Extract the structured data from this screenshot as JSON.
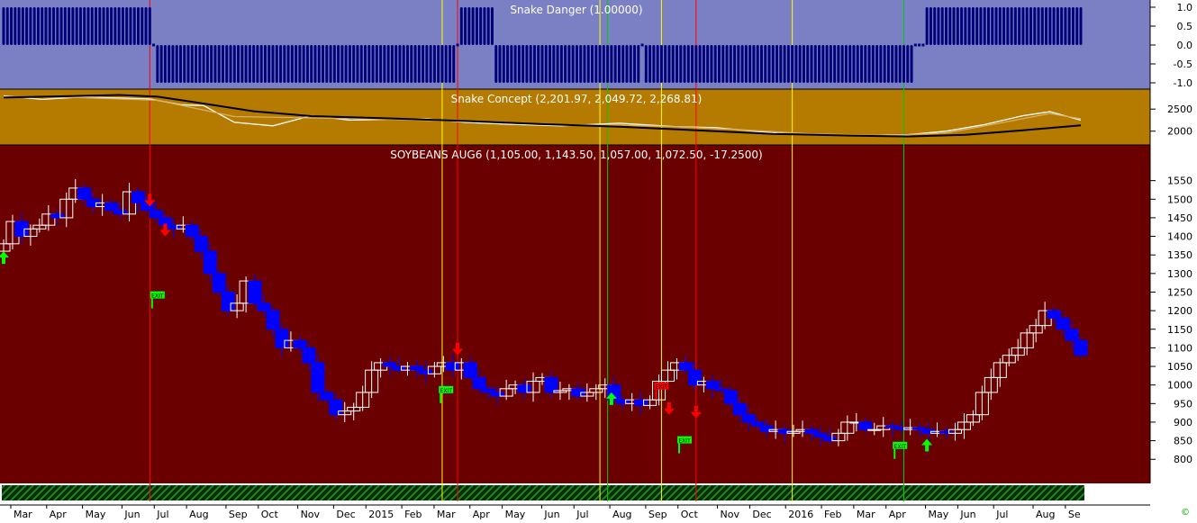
{
  "colors": {
    "danger_bg": "#7b7fc4",
    "concept_bg": "#b57a00",
    "price_bg": "#6b0000",
    "bar_blue": "#0000ff",
    "bar_white": "#ffffff",
    "signal_red": "#ff0000",
    "signal_green": "#00ff00",
    "vline_yellow": "#ffff00",
    "vline_red": "#ff0000",
    "vline_green": "#00cc00",
    "axis_bg": "#ffffff",
    "hatch": "#1a8a1a"
  },
  "chart_data": [
    {
      "type": "bar",
      "title": "Snake Danger (1.00000)",
      "ylim": [
        -1.0,
        1.0
      ],
      "yticks": [
        "1.0",
        "0.5",
        "0.0",
        "-0.5",
        "-1.0"
      ],
      "note_values": "weekly state: 1 = up, -1 = down, 0 = neutral",
      "segments": [
        {
          "from_week": 0,
          "to_week": 38,
          "value": 1
        },
        {
          "from_week": 39,
          "to_week": 39,
          "value": 0
        },
        {
          "from_week": 40,
          "to_week": 117,
          "value": -1
        },
        {
          "from_week": 118,
          "to_week": 118,
          "value": 0
        },
        {
          "from_week": 119,
          "to_week": 127,
          "value": 1
        },
        {
          "from_week": 128,
          "to_week": 165,
          "value": -1
        },
        {
          "from_week": 166,
          "to_week": 166,
          "value": 0
        },
        {
          "from_week": 167,
          "to_week": 236,
          "value": -1
        },
        {
          "from_week": 237,
          "to_week": 239,
          "value": 0
        },
        {
          "from_week": 240,
          "to_week": 280,
          "value": 1
        }
      ]
    },
    {
      "type": "line",
      "title": "Snake Concept (2,201.97, 2,049.72, 2,268.81)",
      "ylim": [
        1750,
        2850
      ],
      "yticks": [
        "2500",
        "2000"
      ],
      "series": [
        {
          "name": "",
          "color": "#ffffff",
          "points": [
            [
              0,
              2800
            ],
            [
              10,
              2720
            ],
            [
              20,
              2770
            ],
            [
              30,
              2750
            ],
            [
              38,
              2730
            ],
            [
              46,
              2600
            ],
            [
              52,
              2580
            ],
            [
              60,
              2200
            ],
            [
              70,
              2120
            ],
            [
              80,
              2350
            ],
            [
              90,
              2250
            ],
            [
              100,
              2270
            ],
            [
              110,
              2280
            ],
            [
              120,
              2200
            ],
            [
              130,
              2160
            ],
            [
              145,
              2120
            ],
            [
              160,
              2180
            ],
            [
              175,
              2100
            ],
            [
              185,
              2080
            ],
            [
              195,
              2000
            ],
            [
              205,
              1930
            ],
            [
              215,
              1920
            ],
            [
              225,
              1900
            ],
            [
              235,
              1920
            ],
            [
              245,
              2000
            ],
            [
              255,
              2150
            ],
            [
              265,
              2350
            ],
            [
              272,
              2440
            ],
            [
              280,
              2250
            ]
          ]
        },
        {
          "name": "",
          "color": "#d9b06a",
          "points": [
            [
              0,
              2780
            ],
            [
              20,
              2760
            ],
            [
              40,
              2700
            ],
            [
              60,
              2330
            ],
            [
              80,
              2300
            ],
            [
              100,
              2270
            ],
            [
              120,
              2220
            ],
            [
              140,
              2150
            ],
            [
              160,
              2140
            ],
            [
              175,
              2100
            ],
            [
              190,
              2040
            ],
            [
              210,
              1940
            ],
            [
              230,
              1900
            ],
            [
              245,
              1960
            ],
            [
              260,
              2200
            ],
            [
              272,
              2400
            ],
            [
              280,
              2280
            ]
          ]
        },
        {
          "name": "",
          "color": "#000000",
          "points": [
            [
              0,
              2760
            ],
            [
              20,
              2800
            ],
            [
              30,
              2820
            ],
            [
              40,
              2780
            ],
            [
              50,
              2650
            ],
            [
              65,
              2450
            ],
            [
              80,
              2340
            ],
            [
              100,
              2290
            ],
            [
              120,
              2230
            ],
            [
              140,
              2160
            ],
            [
              160,
              2100
            ],
            [
              180,
              2020
            ],
            [
              200,
              1940
            ],
            [
              220,
              1900
            ],
            [
              235,
              1880
            ],
            [
              250,
              1920
            ],
            [
              265,
              2020
            ],
            [
              280,
              2130
            ]
          ]
        }
      ]
    },
    {
      "type": "candlestick",
      "title": "SOYBEANS AUG6 (1,105.00, 1,143.50, 1,057.00, 1,072.50, -17.2500)",
      "ylim": [
        740,
        1600
      ],
      "yticks": [
        "1550",
        "1500",
        "1450",
        "1400",
        "1350",
        "1300",
        "1250",
        "1200",
        "1150",
        "1100",
        "1050",
        "1000",
        "950",
        "900",
        "850",
        "800"
      ],
      "weeks": 281,
      "xlabels": [
        {
          "label": "Mar",
          "week": 2
        },
        {
          "label": "Apr",
          "week": 12
        },
        {
          "label": "May",
          "week": 22
        },
        {
          "label": "Jun",
          "week": 33
        },
        {
          "label": "Jul",
          "week": 42
        },
        {
          "label": "Aug",
          "week": 51
        },
        {
          "label": "Sep",
          "week": 62
        },
        {
          "label": "Oct",
          "week": 71
        },
        {
          "label": "Nov",
          "week": 82
        },
        {
          "label": "Dec",
          "week": 92
        },
        {
          "label": "2015",
          "week": 101
        },
        {
          "label": "Feb",
          "week": 111
        },
        {
          "label": "Mar",
          "week": 120
        },
        {
          "label": "Apr",
          "week": 130
        },
        {
          "label": "May",
          "week": 139
        },
        {
          "label": "Jun",
          "week": 150
        },
        {
          "label": "Jul",
          "week": 159
        },
        {
          "label": "Aug",
          "week": 169
        },
        {
          "label": "Sep",
          "week": 179
        },
        {
          "label": "Oct",
          "week": 188
        },
        {
          "label": "Nov",
          "week": 199
        },
        {
          "label": "Dec",
          "week": 208
        },
        {
          "label": "2016",
          "week": 218
        },
        {
          "label": "Feb",
          "week": 228
        },
        {
          "label": "Mar",
          "week": 237
        },
        {
          "label": "Apr",
          "week": 246
        },
        {
          "label": "May",
          "week": 257
        },
        {
          "label": "Jun",
          "week": 266
        },
        {
          "label": "Jul",
          "week": 276
        },
        {
          "label": "Aug",
          "week": 287
        },
        {
          "label": "Se",
          "week": 296
        }
      ],
      "closes": [
        1380,
        1440,
        1400,
        1420,
        1430,
        1460,
        1450,
        1500,
        1530,
        1500,
        1480,
        1490,
        1470,
        1460,
        1520,
        1490,
        1470,
        1450,
        1430,
        1420,
        1430,
        1400,
        1360,
        1300,
        1250,
        1200,
        1220,
        1280,
        1220,
        1200,
        1150,
        1100,
        1120,
        1100,
        1060,
        980,
        960,
        920,
        930,
        940,
        980,
        1040,
        1060,
        1050,
        1040,
        1050,
        1040,
        1030,
        1050,
        1060,
        1040,
        1060,
        1020,
        990,
        980,
        970,
        990,
        1000,
        980,
        1010,
        1020,
        980,
        985,
        990,
        970,
        980,
        990,
        1000,
        960,
        950,
        960,
        945,
        960,
        1010,
        1040,
        1060,
        1040,
        1000,
        1010,
        990,
        985,
        950,
        920,
        900,
        890,
        875,
        880,
        870,
        875,
        880,
        870,
        860,
        850,
        870,
        900,
        900,
        880,
        880,
        890,
        885,
        880,
        885,
        880,
        870,
        875,
        870,
        880,
        900,
        920,
        980,
        1020,
        1060,
        1080,
        1100,
        1140,
        1160,
        1200,
        1180,
        1150,
        1120,
        1080
      ],
      "candles_note": "weekly OHLC approximated; closes listed in reading order from left",
      "arrows": [
        {
          "kind": "up",
          "week": 0,
          "price": 1360
        },
        {
          "kind": "down",
          "week": 38,
          "price": 1480
        },
        {
          "kind": "down",
          "week": 42,
          "price": 1400
        },
        {
          "kind": "up",
          "week": 158,
          "price": 980
        },
        {
          "kind": "down",
          "week": 118,
          "price": 1080
        },
        {
          "kind": "down",
          "week": 173,
          "price": 920
        },
        {
          "kind": "down",
          "week": 180,
          "price": 910
        },
        {
          "kind": "up",
          "week": 240,
          "price": 855
        }
      ],
      "tags": [
        {
          "text": "EXIT",
          "week": 40,
          "price": 1240,
          "color": "#00ff00"
        },
        {
          "text": "EXIT",
          "week": 115,
          "price": 985,
          "color": "#00ff00"
        },
        {
          "text": "EXIT",
          "week": 171,
          "price": 995,
          "color": "#ff0000"
        },
        {
          "text": "EXIT",
          "week": 177,
          "price": 850,
          "color": "#00ff00"
        },
        {
          "text": "EXIT",
          "week": 233,
          "price": 835,
          "color": "#00ff00"
        }
      ],
      "vlines": [
        {
          "week": 38,
          "color": "red"
        },
        {
          "week": 114,
          "color": "yellow"
        },
        {
          "week": 118,
          "color": "red"
        },
        {
          "week": 155,
          "color": "yellow"
        },
        {
          "week": 157,
          "color": "green"
        },
        {
          "week": 171,
          "color": "yellow"
        },
        {
          "week": 180,
          "color": "red"
        },
        {
          "week": 205,
          "color": "yellow"
        },
        {
          "week": 234,
          "color": "green"
        }
      ]
    }
  ],
  "copyright_glyph": "©"
}
